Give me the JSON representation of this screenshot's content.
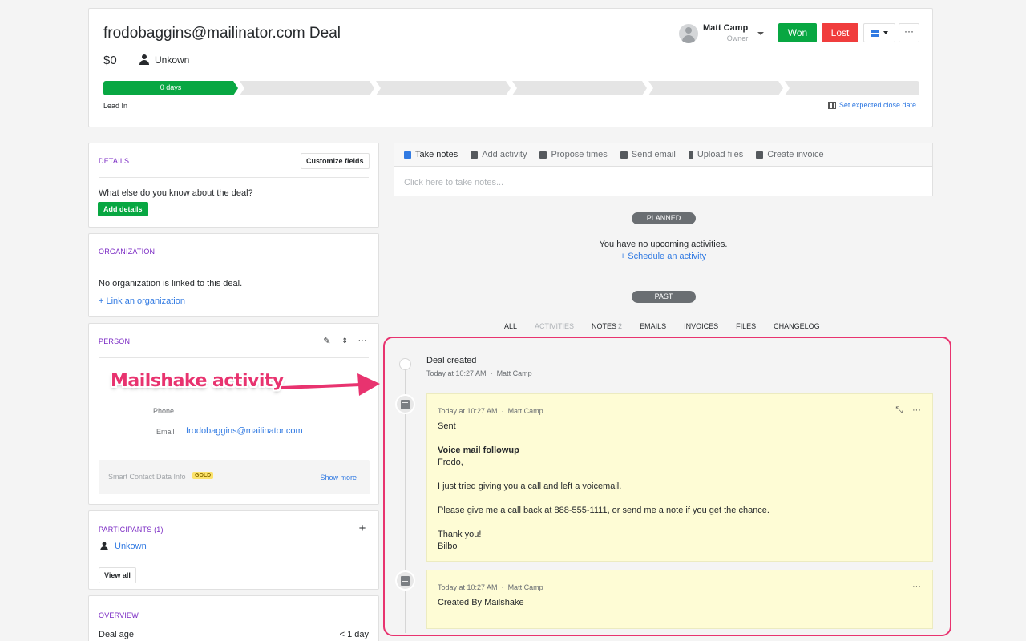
{
  "deal": {
    "title": "frodobaggins@mailinator.com Deal",
    "value": "$0",
    "person": "Unkown"
  },
  "owner": {
    "name": "Matt Camp",
    "role": "Owner"
  },
  "actions": {
    "won_label": "Won",
    "lost_label": "Lost",
    "more_label": "···"
  },
  "pipeline": {
    "active_stage_label": "0 days",
    "stage_name": "Lead In",
    "close_date_label": "Set expected close date"
  },
  "details": {
    "title": "DETAILS",
    "customize_label": "Customize fields",
    "prompt": "What else do you know about the deal?",
    "add_label": "Add details"
  },
  "organization": {
    "title": "ORGANIZATION",
    "empty_text": "No organization is linked to this deal.",
    "link_label": "+ Link an organization"
  },
  "person_section": {
    "title": "PERSON",
    "phone_label": "Phone",
    "email_label": "Email",
    "email_value": "frodobaggins@mailinator.com",
    "smart_label": "Smart Contact Data Info",
    "gold_badge": "GOLD",
    "show_more_label": "Show more"
  },
  "participants": {
    "title": "PARTICIPANTS (1)",
    "items": [
      "Unkown"
    ],
    "view_all_label": "View all"
  },
  "overview": {
    "title": "OVERVIEW",
    "deal_age_label": "Deal age",
    "deal_age_value": "< 1 day"
  },
  "composer": {
    "tabs": [
      "Take notes",
      "Add activity",
      "Propose times",
      "Send email",
      "Upload files",
      "Create invoice"
    ],
    "placeholder": "Click here to take notes..."
  },
  "planned": {
    "pill": "PLANNED",
    "empty_text": "You have no upcoming activities.",
    "schedule_label": "+ Schedule an activity"
  },
  "past": {
    "pill": "PAST",
    "filters": [
      {
        "label": "ALL",
        "count": ""
      },
      {
        "label": "ACTIVITIES",
        "count": ""
      },
      {
        "label": "NOTES",
        "count": "2"
      },
      {
        "label": "EMAILS",
        "count": ""
      },
      {
        "label": "INVOICES",
        "count": ""
      },
      {
        "label": "FILES",
        "count": ""
      },
      {
        "label": "CHANGELOG",
        "count": ""
      }
    ]
  },
  "timeline": {
    "deal_created": {
      "title": "Deal created",
      "time": "Today at 10:27 AM",
      "author": "Matt Camp"
    },
    "note1": {
      "time": "Today at 10:27 AM",
      "author": "Matt Camp",
      "lines": [
        "Sent",
        "",
        "Voice mail followup",
        "Frodo,",
        "",
        "I just tried giving you a call and left a voicemail.",
        "",
        "Please give me a call back at 888-555-1111, or send me a note if you get the chance.",
        "",
        "Thank you!",
        "Bilbo"
      ]
    },
    "note2": {
      "time": "Today at 10:27 AM",
      "author": "Matt Camp",
      "text": "Created By Mailshake"
    }
  },
  "annotation": {
    "text": "Mailshake activity"
  },
  "colors": {
    "accent_green": "#08a742",
    "accent_red": "#f03d3d",
    "link_blue": "#317ae2",
    "annotation_pink": "#e8336f"
  }
}
